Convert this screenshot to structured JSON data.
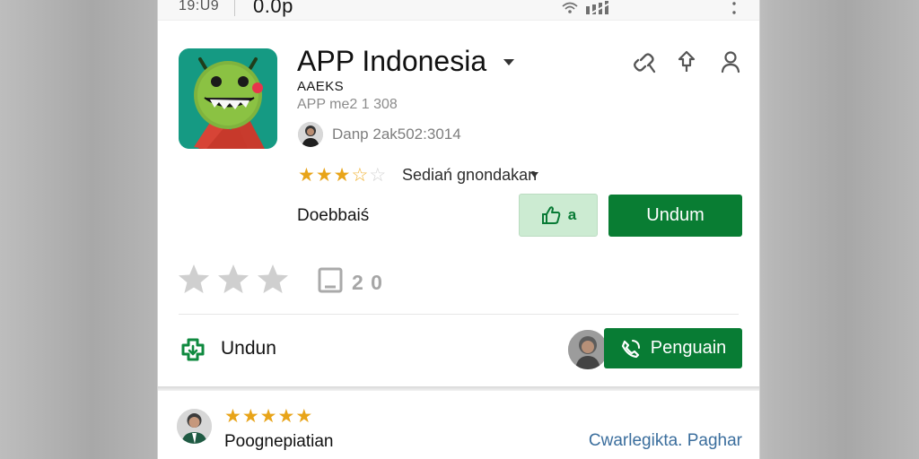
{
  "status_bar": {
    "left_text": "19:U9",
    "clock": "0.0p"
  },
  "app": {
    "title": "APP Indonesia",
    "developer": "AAEKS",
    "meta": "APP me2 1 308",
    "publisher_line": "Danp 2ak502:3014",
    "rating_label": "Sediań gnondakan",
    "description": "Doebbaiś",
    "secondary_action_label": "a",
    "primary_action_label": "Undum",
    "rating_value": 3.5,
    "review_count": "2 0"
  },
  "install_row": {
    "label": "Undun",
    "follow_label": "Penguain"
  },
  "review": {
    "rating": 5,
    "title": "Poognepiatian",
    "link": "Cwarlegikta. Paghar"
  },
  "colors": {
    "green": "#087c34",
    "light_green": "#ccebd2",
    "star_yellow": "#e8a419",
    "link_blue": "#3b6e9d",
    "app_icon_teal": "#159a83"
  },
  "icons": {
    "wifi": "wifi-icon",
    "signal": "signal-icon",
    "more": "more-vertical-icon",
    "share": "share-icon",
    "pin": "pin-icon",
    "account": "account-icon",
    "thumb": "thumb-up-icon",
    "follow": "call-icon"
  }
}
